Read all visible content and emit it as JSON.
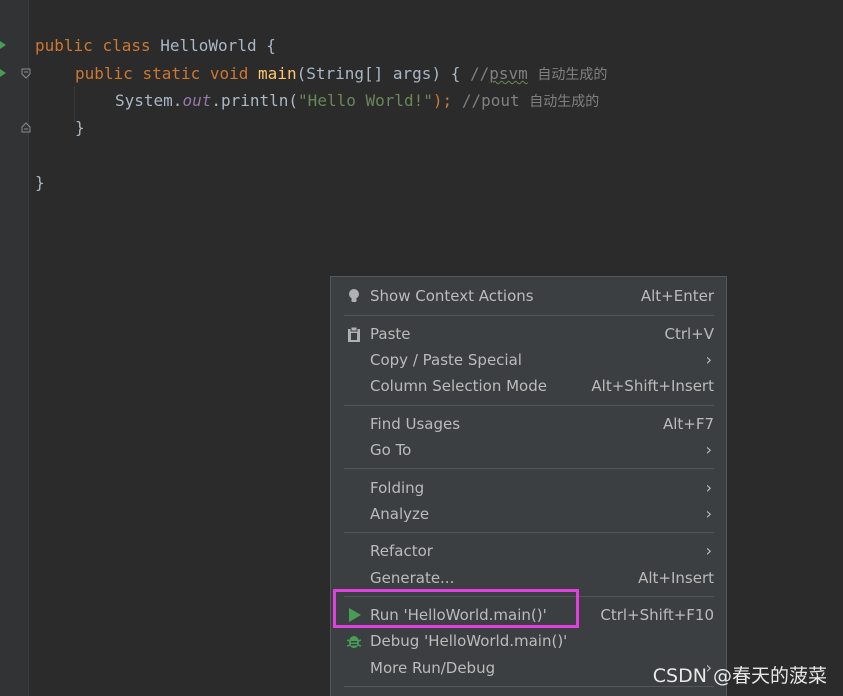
{
  "editor": {
    "line1": {
      "kw1": "public",
      "kw2": "class",
      "name": "HelloWorld",
      "brace": "{"
    },
    "line2": {
      "kw1": "public",
      "kw2": "static",
      "kw3": "void",
      "fn": "main",
      "params": "(String[] args) {",
      "comment_prefix": "//",
      "comment_keyword": "psvm",
      "comment_text": "自动生成的"
    },
    "line3": {
      "obj": "System.",
      "field": "out",
      "call": ".println(",
      "str": "\"Hello World!\"",
      "close": ");",
      "comment_prefix": "//pout ",
      "comment_text": "自动生成的"
    },
    "line4": {
      "brace": "}"
    },
    "line6": {
      "brace": "}"
    }
  },
  "context_menu": {
    "items": [
      {
        "label": "Show Context Actions",
        "shortcut": "Alt+Enter"
      },
      {
        "label": "Paste",
        "shortcut": "Ctrl+V"
      },
      {
        "label": "Copy / Paste Special",
        "submenu_arrow": "›"
      },
      {
        "label": "Column Selection Mode",
        "shortcut": "Alt+Shift+Insert"
      },
      {
        "label": "Find Usages",
        "shortcut": "Alt+F7"
      },
      {
        "label": "Go To",
        "submenu_arrow": "›"
      },
      {
        "label": "Folding",
        "submenu_arrow": "›"
      },
      {
        "label": "Analyze",
        "submenu_arrow": "›"
      },
      {
        "label": "Refactor",
        "submenu_arrow": "›"
      },
      {
        "label": "Generate...",
        "shortcut": "Alt+Insert"
      },
      {
        "label": "Run 'HelloWorld.main()'",
        "shortcut": "Ctrl+Shift+F10"
      },
      {
        "label": "Debug 'HelloWorld.main()'"
      },
      {
        "label": "More Run/Debug",
        "submenu_arrow": "›"
      }
    ]
  },
  "icons": {
    "show_context_actions": "lightbulb-icon",
    "paste": "clipboard-icon",
    "run": "run-triangle-icon",
    "debug": "bug-icon",
    "gutter_run": "gutter-run-icon",
    "gutter_fold": "fold-icon"
  },
  "colors": {
    "highlight_box": "#e040e0",
    "run_green": "#499c54",
    "background": "#2b2b2b",
    "menu_background": "#3c3f41"
  },
  "watermark": "CSDN @春天的菠菜"
}
